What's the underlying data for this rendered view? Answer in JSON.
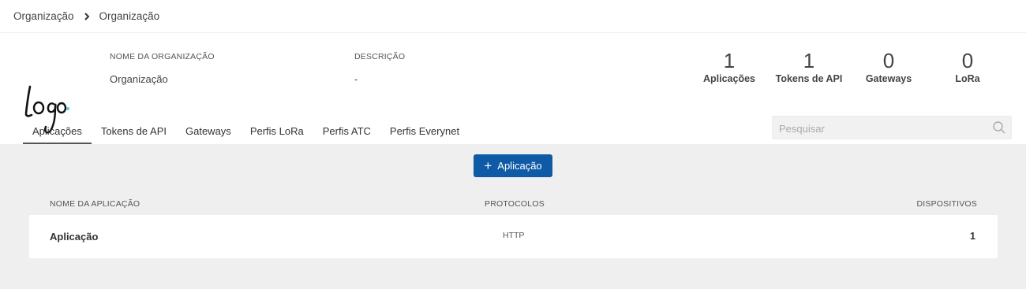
{
  "breadcrumb": {
    "items": [
      "Organização",
      "Organização"
    ]
  },
  "organization": {
    "name_label": "NOME DA ORGANIZAÇÃO",
    "name": "Organização",
    "description_label": "DESCRIÇÃO",
    "description": "-",
    "logo_text": "Logo"
  },
  "stats": [
    {
      "value": "1",
      "label": "Aplicações"
    },
    {
      "value": "1",
      "label": "Tokens de API"
    },
    {
      "value": "0",
      "label": "Gateways"
    },
    {
      "value": "0",
      "label": "LoRa"
    }
  ],
  "tabs": [
    {
      "label": "Aplicações",
      "active": true
    },
    {
      "label": "Tokens de API"
    },
    {
      "label": "Gateways"
    },
    {
      "label": "Perfis LoRa"
    },
    {
      "label": "Perfis ATC"
    },
    {
      "label": "Perfis Everynet"
    }
  ],
  "search": {
    "placeholder": "Pesquisar",
    "value": "",
    "icon": "search-icon"
  },
  "add_button": {
    "label": "Aplicação",
    "icon": "plus-icon"
  },
  "table": {
    "columns": [
      "NOME DA APLICAÇÃO",
      "PROTOCOLOS",
      "DISPOSITIVOS"
    ],
    "rows": [
      {
        "name": "Aplicação",
        "protocol": "HTTP",
        "devices": "1"
      }
    ]
  },
  "colors": {
    "primary": "#0e5aa7",
    "content_bg": "#efefef"
  }
}
